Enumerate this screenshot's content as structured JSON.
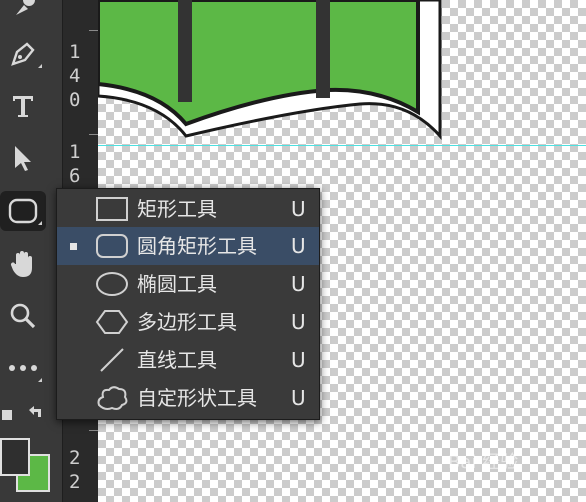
{
  "ruler": {
    "labels_top": [
      "1",
      "4",
      "0"
    ],
    "labels_mid": [
      "1",
      "6"
    ],
    "labels_bottom": [
      "2",
      "2"
    ]
  },
  "flyout": {
    "items": [
      {
        "label": "矩形工具",
        "shortcut": "U",
        "icon": "rectangle-icon",
        "selected": false
      },
      {
        "label": "圆角矩形工具",
        "shortcut": "U",
        "icon": "rounded-rectangle-icon",
        "selected": true
      },
      {
        "label": "椭圆工具",
        "shortcut": "U",
        "icon": "ellipse-icon",
        "selected": false
      },
      {
        "label": "多边形工具",
        "shortcut": "U",
        "icon": "polygon-icon",
        "selected": false
      },
      {
        "label": "直线工具",
        "shortcut": "U",
        "icon": "line-icon",
        "selected": false
      },
      {
        "label": "自定形状工具",
        "shortcut": "U",
        "icon": "custom-shape-icon",
        "selected": false
      }
    ]
  },
  "colors": {
    "foreground": "#2f2f2f",
    "background": "#5cb846",
    "selection": "#3a4d66",
    "guide": "#4ee0e0",
    "banner_green": "#5cb846"
  },
  "watermark": "Bai 经验"
}
